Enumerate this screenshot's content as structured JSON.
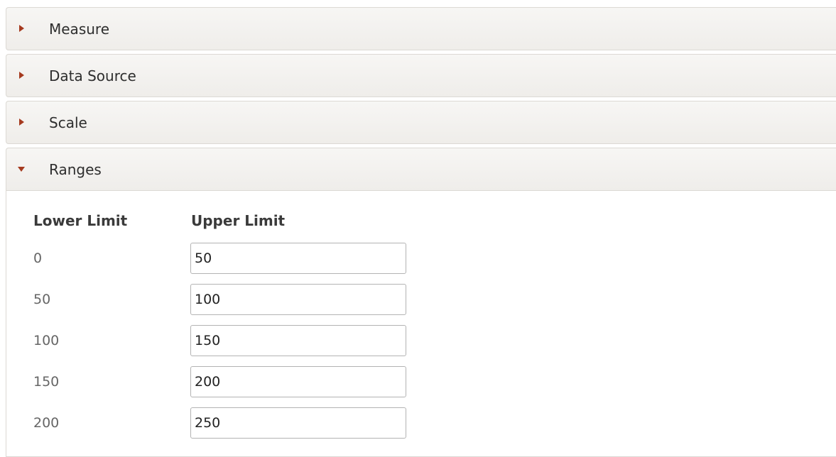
{
  "sections": [
    {
      "label": "Measure",
      "expanded": false
    },
    {
      "label": "Data Source",
      "expanded": false
    },
    {
      "label": "Scale",
      "expanded": false
    },
    {
      "label": "Ranges",
      "expanded": true
    }
  ],
  "ranges": {
    "lower_header": "Lower Limit",
    "upper_header": "Upper Limit",
    "rows": [
      {
        "lower": "0",
        "upper": "50"
      },
      {
        "lower": "50",
        "upper": "100"
      },
      {
        "lower": "100",
        "upper": "150"
      },
      {
        "lower": "150",
        "upper": "200"
      },
      {
        "lower": "200",
        "upper": "250"
      }
    ]
  },
  "colors": {
    "caret": "#a53a1f",
    "header_bg": "#f2f0ed",
    "border": "#dcd9d4"
  },
  "icons": {
    "collapsed": "caret-right-icon",
    "expanded": "caret-down-icon"
  }
}
